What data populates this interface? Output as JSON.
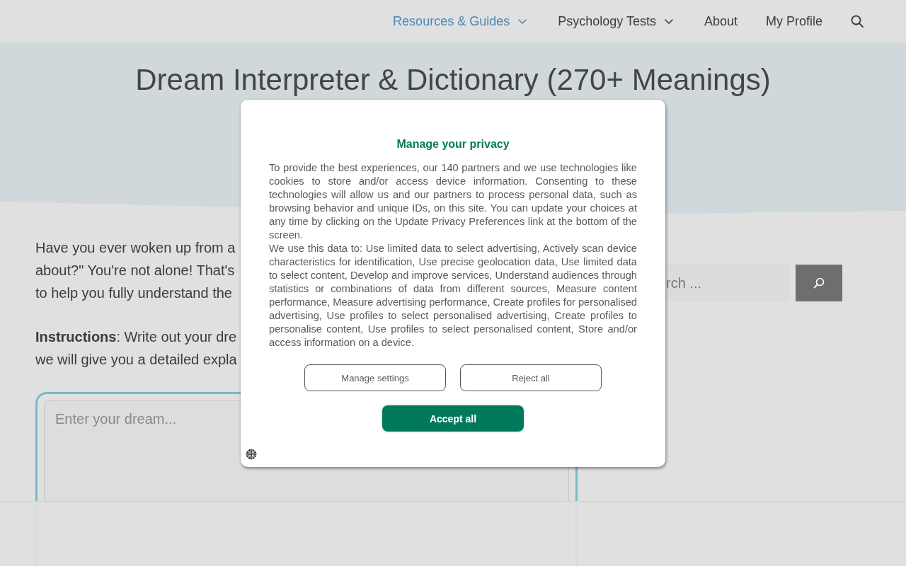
{
  "nav": {
    "items": [
      {
        "label": "Resources & Guides",
        "has_dropdown": true,
        "selected": true
      },
      {
        "label": "Psychology Tests",
        "has_dropdown": true,
        "selected": false
      },
      {
        "label": "About",
        "has_dropdown": false,
        "selected": false
      },
      {
        "label": "My Profile",
        "has_dropdown": false,
        "selected": false
      }
    ]
  },
  "hero": {
    "title": "Dream Interpreter & Dictionary (270+ Meanings)"
  },
  "intro": {
    "lines": [
      "Have you ever woken up from a",
      "about?\" You're not alone! That's",
      "to help you fully understand the"
    ]
  },
  "instructions": {
    "lines": [
      "**Instructions**: Write out your dre",
      "we will give you a detailed expla"
    ]
  },
  "dream_input": {
    "placeholder": "Enter your dream..."
  },
  "sidebar": {
    "search": {
      "placeholder": "rch ..."
    }
  },
  "privacy_dialog": {
    "title": "Manage your privacy",
    "paragraphs": [
      "To provide the best experiences, our 140 partners and we use technologies like cookies to store and/or access device information. Consenting to these technologies will allow us and our partners to process personal data, such as browsing behavior and unique IDs, on this site. You can update your choices at any time by clicking on the Update Privacy Preferences link at the bottom of the screen.",
      "We use this data to: Use limited data to select advertising, Actively scan device characteristics for identification, Use precise geolocation data, Use limited data to select content, Develop and improve services, Understand audiences through statistics or combinations of data from different sources, Measure content performance, Measure advertising performance, Create profiles for personalised advertising, Use profiles to select personalised advertising, Create profiles to personalise content, Use profiles to select personalised content, Store and/or access information on a device."
    ],
    "buttons": [
      {
        "label": "Manage settings",
        "kind": "outline"
      },
      {
        "label": "Reject all",
        "kind": "outline"
      },
      {
        "label": "Accept all",
        "kind": "primary"
      }
    ]
  }
}
